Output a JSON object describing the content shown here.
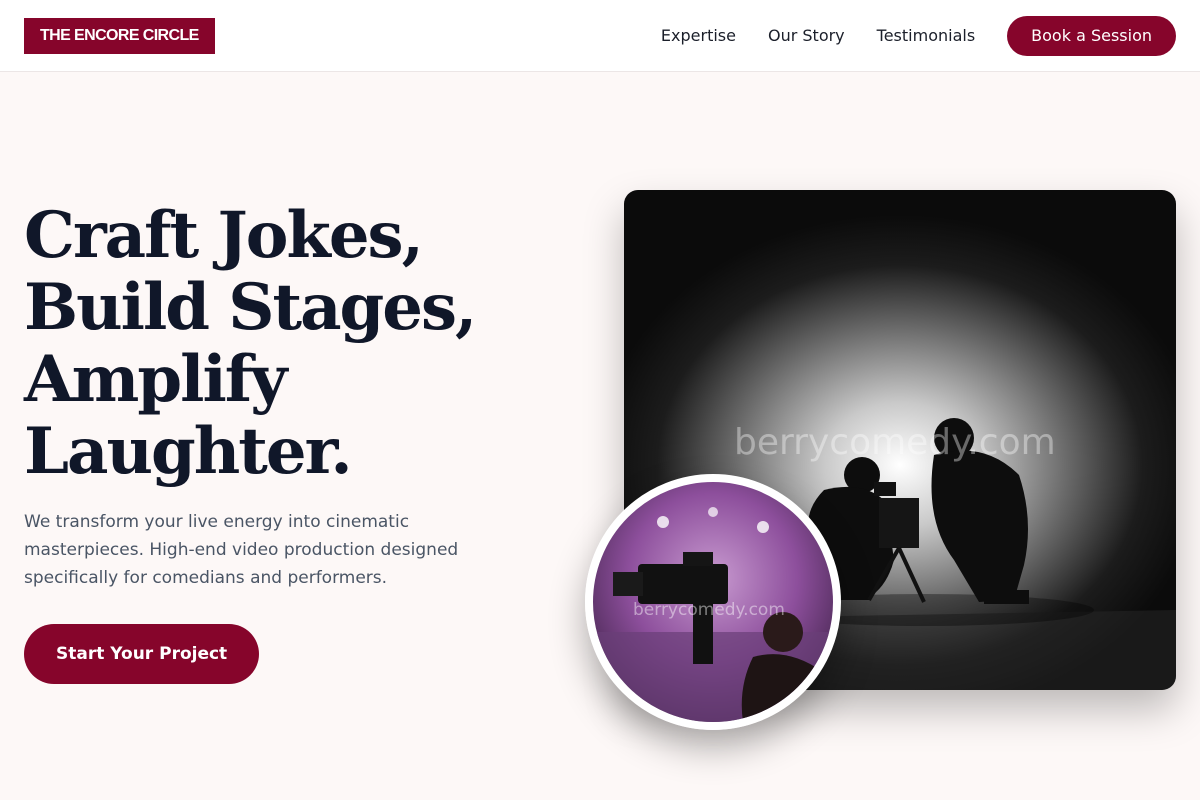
{
  "header": {
    "logo": "THE ENCORE CIRCLE",
    "nav": [
      "Expertise",
      "Our Story",
      "Testimonials"
    ],
    "cta": "Book a Session"
  },
  "hero": {
    "headline": [
      "Craft Jokes,",
      "Build Stages,",
      "Amplify",
      "Laughter."
    ],
    "subtext": "We transform your live energy into cinematic masterpieces. High-end video production designed specifically for comedians and performers.",
    "cta": "Start Your Project"
  },
  "images": {
    "main_watermark": "berrycomedy.com",
    "circle_watermark": "berrycomedy.com"
  },
  "colors": {
    "brand": "#86052b",
    "background": "#fdf8f7",
    "heading": "#101729"
  }
}
